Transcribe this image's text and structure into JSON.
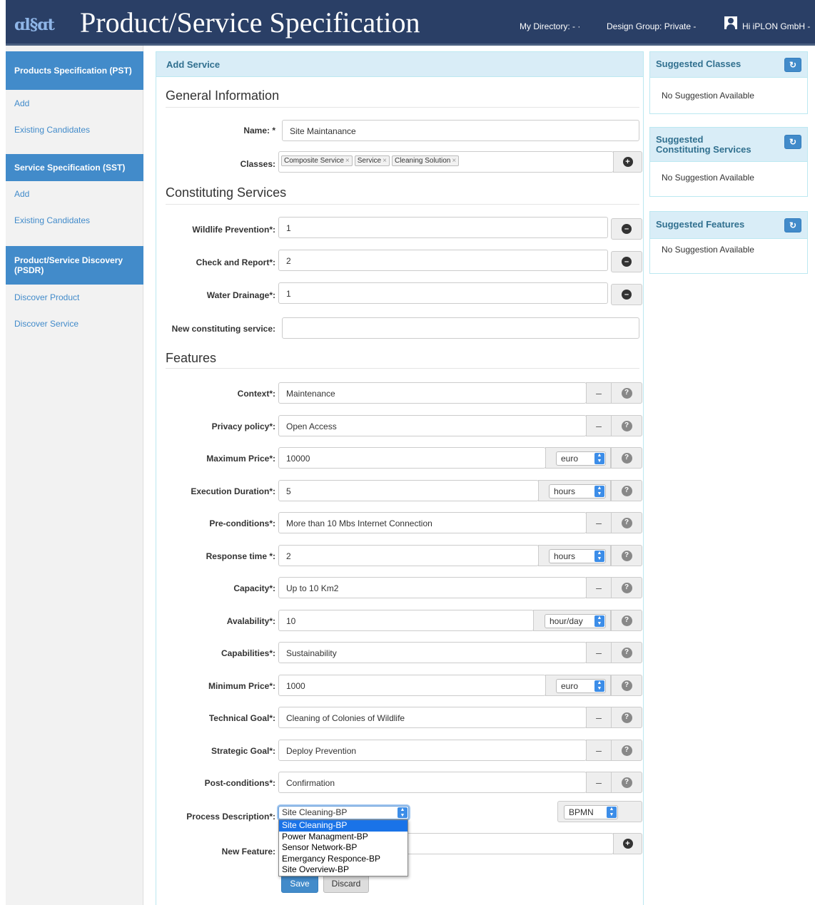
{
  "header": {
    "logo": "ɑl§ɑt",
    "title": "Product/Service Specification",
    "my_directory": "My Directory: - ·",
    "design_group": "Design Group: Private -",
    "user": "Hi iPLON GmbH -"
  },
  "sidebar": {
    "pst_title": "Products Specification (PST)",
    "pst_add": "Add",
    "pst_existing": "Existing Candidates",
    "sst_title": "Service Specification (SST)",
    "sst_add": "Add",
    "sst_existing": "Existing Candidates",
    "psdr_title": "Product/Service Discovery (PSDR)",
    "discover_product": "Discover Product",
    "discover_service": "Discover Service"
  },
  "main": {
    "panel_title": "Add Service",
    "general_info": "General Information",
    "name_label": "Name: *",
    "name_value": "Site Maintanance",
    "classes_label": "Classes:",
    "classes": [
      "Composite Service",
      "Service",
      "Cleaning Solution"
    ],
    "constituting_title": "Constituting Services",
    "constituting": [
      {
        "label": "Wildlife Prevention*:",
        "value": "1"
      },
      {
        "label": "Check and Report*:",
        "value": "2"
      },
      {
        "label": "Water Drainage*:",
        "value": "1"
      }
    ],
    "new_constituting_label": "New constituting service:",
    "features_title": "Features",
    "features": [
      {
        "label": "Context*:",
        "value": "Maintenance"
      },
      {
        "label": "Privacy policy*:",
        "value": "Open Access"
      },
      {
        "label": "Maximum Price*:",
        "value": "10000",
        "unit": "euro"
      },
      {
        "label": "Execution Duration*:",
        "value": "5",
        "unit": "hours"
      },
      {
        "label": "Pre-conditions*:",
        "value": "More than 10 Mbs Internet Connection"
      },
      {
        "label": "Response time *:",
        "value": "2",
        "unit": "hours"
      },
      {
        "label": "Capacity*:",
        "value": "Up to 10 Km2"
      },
      {
        "label": "Avalability*:",
        "value": "10",
        "unit": "hour/day"
      },
      {
        "label": "Capabilities*:",
        "value": "Sustainability"
      },
      {
        "label": "Minimum Price*:",
        "value": "1000",
        "unit": "euro"
      },
      {
        "label": "Technical Goal*:",
        "value": "Cleaning of Colonies of Wildlife"
      },
      {
        "label": "Strategic Goal*:",
        "value": "Deploy Prevention"
      },
      {
        "label": "Post-conditions*:",
        "value": "Confirmation"
      }
    ],
    "question_glyph": "?",
    "minus_glyph": "–",
    "process_label": "Process Description*:",
    "process_selected": "Site Cleaning-BP",
    "process_options": [
      "Site Cleaning-BP",
      "Power Managment-BP",
      "Sensor Network-BP",
      "Emergancy Responce-BP",
      "Site Overview-BP"
    ],
    "process_type": "BPMN",
    "new_feature_label": "New Feature:",
    "save_label": "Save",
    "discard_label": "Discard"
  },
  "right": {
    "classes_title": "Suggested Classes",
    "classes_body": "No Suggestion Available",
    "constituting_title": "Suggested Constituting Services",
    "constituting_body": "No Suggestion Available",
    "features_title": "Suggested Features",
    "features_body": "No Suggestion Available"
  },
  "colors": {
    "header_bg": "#2a3f66",
    "sidebar_active": "#428bca",
    "panel_head": "#d9edf7",
    "link": "#428bca"
  }
}
